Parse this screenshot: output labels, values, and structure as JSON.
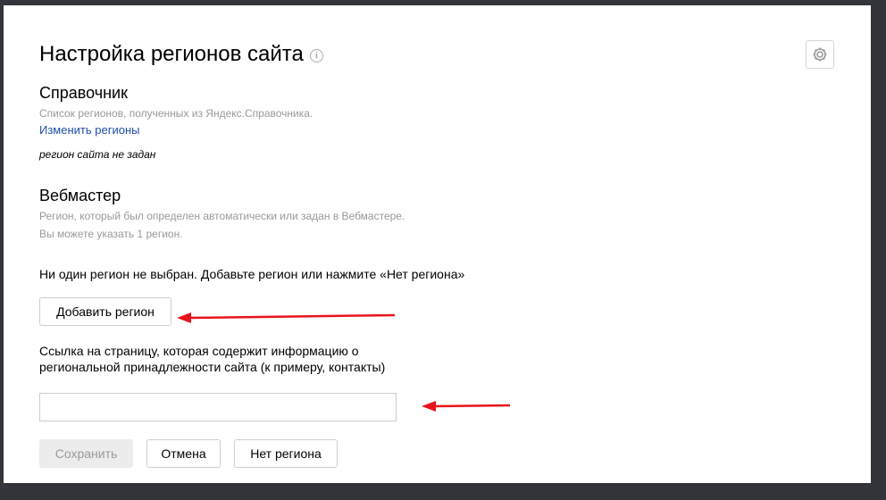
{
  "header": {
    "title": "Настройка регионов сайта",
    "info_icon": "info-circle-icon",
    "settings_icon": "gear-icon"
  },
  "directory": {
    "heading": "Справочник",
    "description": "Список регионов, полученных из Яндекс.Справочника.",
    "change_link": "Изменить регионы",
    "status": "регион сайта не задан"
  },
  "webmaster": {
    "heading": "Вебмастер",
    "description_line1": "Регион, который был определен автоматически или задан в Вебмастере.",
    "description_line2": "Вы можете указать 1 регион.",
    "no_region_message": "Ни один регион не выбран. Добавьте регион или нажмите «Нет региона»",
    "add_region_label": "Добавить регион",
    "link_field_label": "Ссылка на страницу, которая содержит информацию о региональной принадлежности сайта (к примеру, контакты)",
    "link_field_value": "",
    "link_field_placeholder": ""
  },
  "actions": {
    "save_label": "Сохранить",
    "cancel_label": "Отмена",
    "no_region_label": "Нет региона"
  },
  "colors": {
    "annotation_arrow": "#e8141b",
    "link": "#1f4fa8",
    "background": "#33353b"
  }
}
